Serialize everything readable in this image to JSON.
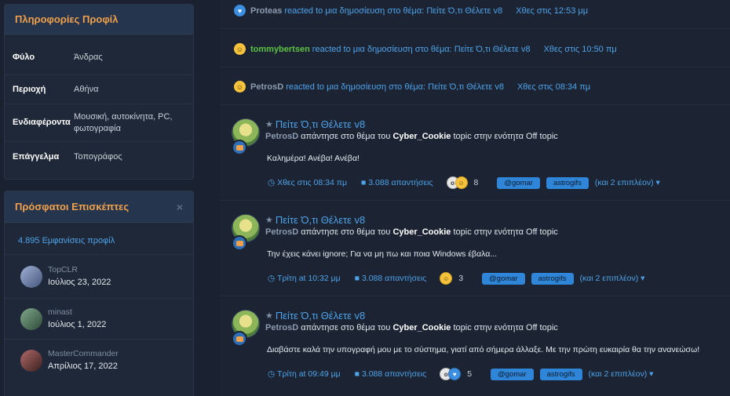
{
  "profile_info": {
    "title": "Πληροφορίες Προφίλ",
    "rows": [
      {
        "label": "Φύλο",
        "value": "Άνδρας"
      },
      {
        "label": "Περιοχή",
        "value": "Αθήνα"
      },
      {
        "label": "Ενδιαφέροντα",
        "value": "Μουσική, αυτοκίνητα, PC, φωτογραφία"
      },
      {
        "label": "Επάγγελμα",
        "value": "Τοπογράφος"
      }
    ]
  },
  "recent_visitors": {
    "title": "Πρόσφατοι Επισκέπτες",
    "close": "×",
    "profile_views": "4.895 Εμφανίσεις προφίλ",
    "visitors": [
      {
        "name": "TopCLR",
        "date": "Ιούλιος 23, 2022",
        "avatar_color": "#6a7fa8"
      },
      {
        "name": "minast",
        "date": "Ιούλιος 1, 2022",
        "avatar_color": "#4d7a5a"
      },
      {
        "name": "MasterCommander",
        "date": "Απρίλιος 17, 2022",
        "avatar_color": "#7a3e3e"
      }
    ]
  },
  "reactions": [
    {
      "icon": "heart-icon",
      "user": "Proteas",
      "user_color": "#8c9bb0",
      "text": "reacted to μια δημοσίευση στο θέμα: Πείτε Ό,τι Θέλετε v8",
      "time": "Χθες στις 12:53 μμ"
    },
    {
      "icon": "haha-icon",
      "user": "tommybertsen",
      "user_color": "#5cc142",
      "text": "reacted to μια δημοσίευση στο θέμα: Πείτε Ό,τι Θέλετε v8",
      "time": "Χθες στις 10:50 πμ"
    },
    {
      "icon": "haha-icon",
      "user": "PetrosD",
      "user_color": "#8c9bb0",
      "text": "reacted to μια δημοσίευση στο θέμα: Πείτε Ό,τι Θέλετε v8",
      "time": "Χθες στις 08:34 πμ"
    }
  ],
  "posts": [
    {
      "title": "Πείτε Ό,τι Θέλετε v8",
      "author": "PetrosD",
      "action": "απάντησε στο θέμα του",
      "topic_owner": "Cyber_Cookie",
      "section_text": "topic στην ενότητα Off topic",
      "body": "Καλημέρα! Ανέβα! Ανέβα!",
      "time": "Χθες στις 08:34 πμ",
      "replies": "3.088 απαντήσεις",
      "reaction_count": "8",
      "tags": [
        "@gomar",
        "astrogifs"
      ],
      "more": "(και 2 επιπλέον)"
    },
    {
      "title": "Πείτε Ό,τι Θέλετε v8",
      "author": "PetrosD",
      "action": "απάντησε στο θέμα του",
      "topic_owner": "Cyber_Cookie",
      "section_text": "topic στην ενότητα Off topic",
      "body": "Την έχεις κάνει ignore; Για να μη πω και ποια Windows έβαλα...",
      "time": "Τρίτη at 10:32 μμ",
      "replies": "3.088 απαντήσεις",
      "reaction_count": "3",
      "tags": [
        "@gomar",
        "astrogifs"
      ],
      "more": "(και 2 επιπλέον)"
    },
    {
      "title": "Πείτε Ό,τι Θέλετε v8",
      "author": "PetrosD",
      "action": "απάντησε στο θέμα του",
      "topic_owner": "Cyber_Cookie",
      "section_text": "topic στην ενότητα Off topic",
      "body": "Διαβάστε καλά την υπογραφή μου με το σύστημα, γιατί από σήμερα άλλαξε. Με την πρώτη ευκαιρία θα την ανανεώσω!",
      "time": "Τρίτη at 09:49 μμ",
      "replies": "3.088 απαντήσεις",
      "reaction_count": "5",
      "tags": [
        "@gomar",
        "astrogifs"
      ],
      "more": "(και 2 επιπλέον)"
    }
  ]
}
